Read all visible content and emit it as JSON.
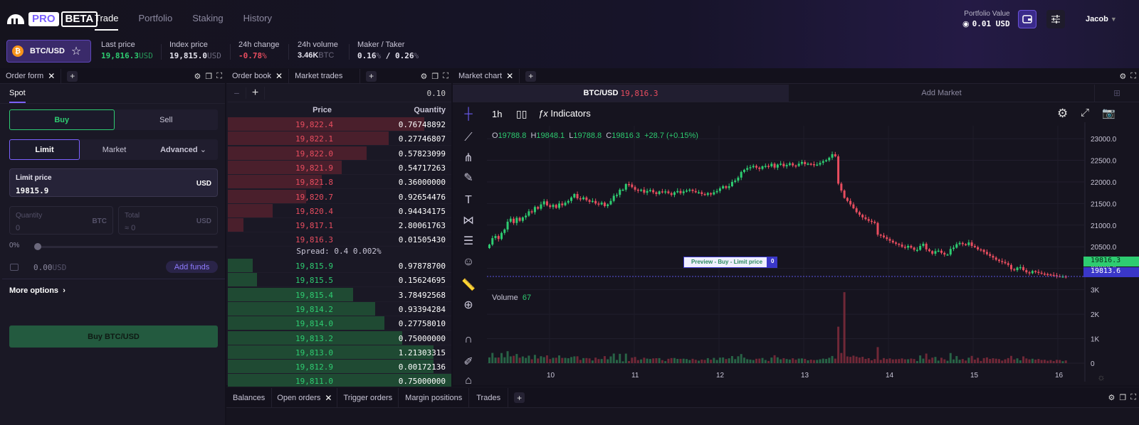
{
  "header": {
    "logo_pro": "PRO",
    "logo_beta": "BETA",
    "nav": [
      {
        "label": "Trade",
        "active": true
      },
      {
        "label": "Portfolio",
        "active": false
      },
      {
        "label": "Staking",
        "active": false
      },
      {
        "label": "History",
        "active": false
      }
    ],
    "pair": {
      "icon": "bitcoin-icon",
      "label": "BTC/USD"
    },
    "stats": [
      {
        "label": "Last price",
        "value": "19,816.3",
        "unit": "USD",
        "tone": "up"
      },
      {
        "label": "Index price",
        "value": "19,815.0",
        "unit": "USD",
        "tone": "neutral"
      },
      {
        "label": "24h change",
        "value": "-0.78",
        "unit": "%",
        "tone": "down"
      },
      {
        "label": "24h volume",
        "value": "3.46K",
        "unit": "BTC",
        "tone": "neutral"
      },
      {
        "label": "Maker / Taker",
        "value": "0.16",
        "unit": "%",
        "value2": "0.26",
        "unit2": "%",
        "tone": "neutral"
      }
    ],
    "portfolio": {
      "label": "Portfolio Value",
      "value": "0.01 USD"
    },
    "user": "Jacob"
  },
  "order_form": {
    "tab": "Order form",
    "subtab": "Spot",
    "side": {
      "buy": "Buy",
      "sell": "Sell",
      "selected": "Buy"
    },
    "type": {
      "limit": "Limit",
      "market": "Market",
      "advanced": "Advanced",
      "selected": "Limit"
    },
    "limit_price": {
      "label": "Limit price",
      "value": "19815.9",
      "unit": "USD"
    },
    "quantity": {
      "label": "Quantity",
      "placeholder": "0",
      "unit": "BTC"
    },
    "total": {
      "label": "Total",
      "placeholder": "≈ 0",
      "unit": "USD"
    },
    "slider": {
      "label": "0%",
      "value": 0
    },
    "balance": {
      "value": "0.00",
      "unit": "USD"
    },
    "add_funds": "Add funds",
    "more_options": "More options",
    "submit": "Buy BTC/USD"
  },
  "order_book": {
    "tabs": [
      "Order book",
      "Market trades"
    ],
    "tick": "0.10",
    "headers": {
      "price": "Price",
      "quantity": "Quantity"
    },
    "asks": [
      {
        "price": "19,822.4",
        "qty": "0.76748892",
        "depth": 0.88
      },
      {
        "price": "19,822.1",
        "qty": "0.27746807",
        "depth": 0.72
      },
      {
        "price": "19,822.0",
        "qty": "0.57823099",
        "depth": 0.62
      },
      {
        "price": "19,821.9",
        "qty": "0.54717263",
        "depth": 0.51
      },
      {
        "price": "19,821.8",
        "qty": "0.36000000",
        "depth": 0.42
      },
      {
        "price": "19,820.7",
        "qty": "0.92654476",
        "depth": 0.35
      },
      {
        "price": "19,820.4",
        "qty": "0.94434175",
        "depth": 0.2
      },
      {
        "price": "19,817.1",
        "qty": "2.80061763",
        "depth": 0.07
      },
      {
        "price": "19,816.3",
        "qty": "0.01505430",
        "depth": 0.0
      }
    ],
    "spread": "Spread: 0.4  0.002%",
    "bids": [
      {
        "price": "19,815.9",
        "qty": "0.97878700",
        "depth": 0.11
      },
      {
        "price": "19,815.5",
        "qty": "0.15624695",
        "depth": 0.13
      },
      {
        "price": "19,815.4",
        "qty": "3.78492568",
        "depth": 0.56
      },
      {
        "price": "19,814.2",
        "qty": "0.93394284",
        "depth": 0.66
      },
      {
        "price": "19,814.0",
        "qty": "0.27758010",
        "depth": 0.7
      },
      {
        "price": "19,813.2",
        "qty": "0.75000000",
        "depth": 0.78
      },
      {
        "price": "19,813.0",
        "qty": "1.21303315",
        "depth": 0.92
      },
      {
        "price": "19,812.9",
        "qty": "0.00172136",
        "depth": 0.92
      },
      {
        "price": "19,811.0",
        "qty": "0.75000000",
        "depth": 1.0
      }
    ]
  },
  "market_chart": {
    "tab": "Market chart",
    "market_tab": {
      "pair": "BTC/USD",
      "price": "19,816.3"
    },
    "add_market": "Add Market",
    "interval": "1h",
    "indicators": "Indicators",
    "ohlc": {
      "o": "19788.8",
      "h": "19848.1",
      "l": "19788.8",
      "c": "19816.3",
      "change": "+28.7 (+0.15%)"
    },
    "volume_label": "Volume",
    "volume_value": "67",
    "order_preview": {
      "label": "Preview - Buy - Limit price",
      "qty": "0"
    },
    "price_tags": {
      "last": "19816.3",
      "limit": "19813.6"
    },
    "tools": [
      "crosshair-icon",
      "trend-line-icon",
      "pitchfork-icon",
      "brush-icon",
      "text-icon",
      "pattern-icon",
      "measure-range-icon",
      "emoji-icon",
      "ruler-icon",
      "zoom-in-icon",
      "magnet-icon",
      "lock-drawing-icon",
      "trash-icon"
    ]
  },
  "chart_data": {
    "type": "candlestick",
    "title": "BTC/USD 1h",
    "x_ticks": [
      "10",
      "11",
      "12",
      "13",
      "14",
      "15",
      "16"
    ],
    "y_ticks": [
      "23000.0",
      "22500.0",
      "22000.0",
      "21500.0",
      "21000.0",
      "20500.0",
      "20000.0"
    ],
    "ylim": [
      19600,
      23100
    ],
    "volume_ticks": [
      "3K",
      "2K",
      "1K",
      "0"
    ],
    "volume_ylim": [
      0,
      3600
    ],
    "closes": [
      20550,
      20700,
      20750,
      20680,
      20820,
      20900,
      21080,
      21150,
      21050,
      21170,
      21100,
      21180,
      21220,
      21320,
      21300,
      21420,
      21380,
      21480,
      21550,
      21460,
      21420,
      21470,
      21400,
      21500,
      21460,
      21520,
      21560,
      21640,
      21720,
      21620,
      21600,
      21640,
      21580,
      21540,
      21560,
      21500,
      21480,
      21520,
      21440,
      21480,
      21560,
      21680,
      21700,
      21820,
      21820,
      21950,
      21940,
      21880,
      21820,
      21800,
      21820,
      21750,
      21790,
      21810,
      21760,
      21720,
      21780,
      21770,
      21780,
      21740,
      21700,
      21760,
      21790,
      21740,
      21780,
      21800,
      21820,
      21790,
      21760,
      21760,
      21720,
      21700,
      21740,
      21710,
      21760,
      21790,
      21850,
      21900,
      21860,
      21900,
      22000,
      22030,
      22100,
      22230,
      22280,
      22320,
      22340,
      22370,
      22330,
      22300,
      22360,
      22370,
      22360,
      22420,
      22330,
      22400,
      22420,
      22360,
      22390,
      22430,
      22380,
      22370,
      22420,
      22460,
      22410,
      22420,
      22410,
      22390,
      22400,
      22440,
      22480,
      22500,
      22560,
      22640,
      22590,
      21960,
      21800,
      21630,
      21560,
      21480,
      21390,
      21300,
      21240,
      21180,
      21140,
      21100,
      21080,
      21050,
      20780,
      20760,
      20720,
      20680,
      20640,
      20600,
      20570,
      20550,
      20500,
      20480,
      20520,
      20480,
      20430,
      20430,
      20520,
      20570,
      20440,
      20400,
      20340,
      20400,
      20410,
      20360,
      20320,
      20320,
      20450,
      20480,
      20560,
      20590,
      20560,
      20540,
      20600,
      20520,
      20490,
      20440,
      20430,
      20380,
      20330,
      20290,
      20250,
      20200,
      20170,
      20150,
      20120,
      20080,
      19980,
      19960,
      20020,
      20030,
      19960,
      19910,
      19890,
      19940,
      19920,
      19900,
      19880,
      19870,
      19860,
      19850,
      19840,
      19820,
      19817,
      19817,
      19816
    ],
    "highlight_volume_index": 117
  },
  "bottom_panel": {
    "tabs": [
      "Balances",
      "Open orders",
      "Trigger orders",
      "Margin positions",
      "Trades"
    ],
    "closable_tab": "Open orders"
  },
  "colors": {
    "up": "#2ecc71",
    "down": "#e84d5f",
    "accent": "#7b61ff",
    "bg": "#13111c",
    "panel": "#1a1825"
  }
}
